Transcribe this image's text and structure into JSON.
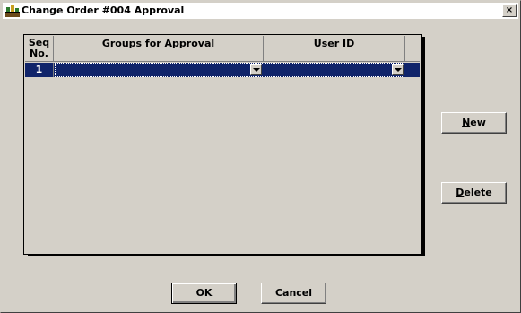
{
  "window": {
    "title": "Change Order #004 Approval",
    "close_glyph": "×"
  },
  "grid": {
    "columns": [
      {
        "label_line1": "Seq",
        "label_line2": "No."
      },
      {
        "label": "Groups for Approval"
      },
      {
        "label": "User ID"
      }
    ],
    "rows": [
      {
        "seq": "1",
        "group": "",
        "user_id": ""
      }
    ]
  },
  "buttons": {
    "new_label": "New",
    "new_mnemonic": "N",
    "new_rest": "ew",
    "delete_label": "Delete",
    "delete_mnemonic": "D",
    "delete_rest": "elete",
    "ok_label": "OK",
    "cancel_label": "Cancel"
  },
  "colors": {
    "selection": "#10246a",
    "face": "#d4d0c8"
  },
  "icons": {
    "app": "app-icon",
    "dropdown": "chevron-down-icon"
  }
}
